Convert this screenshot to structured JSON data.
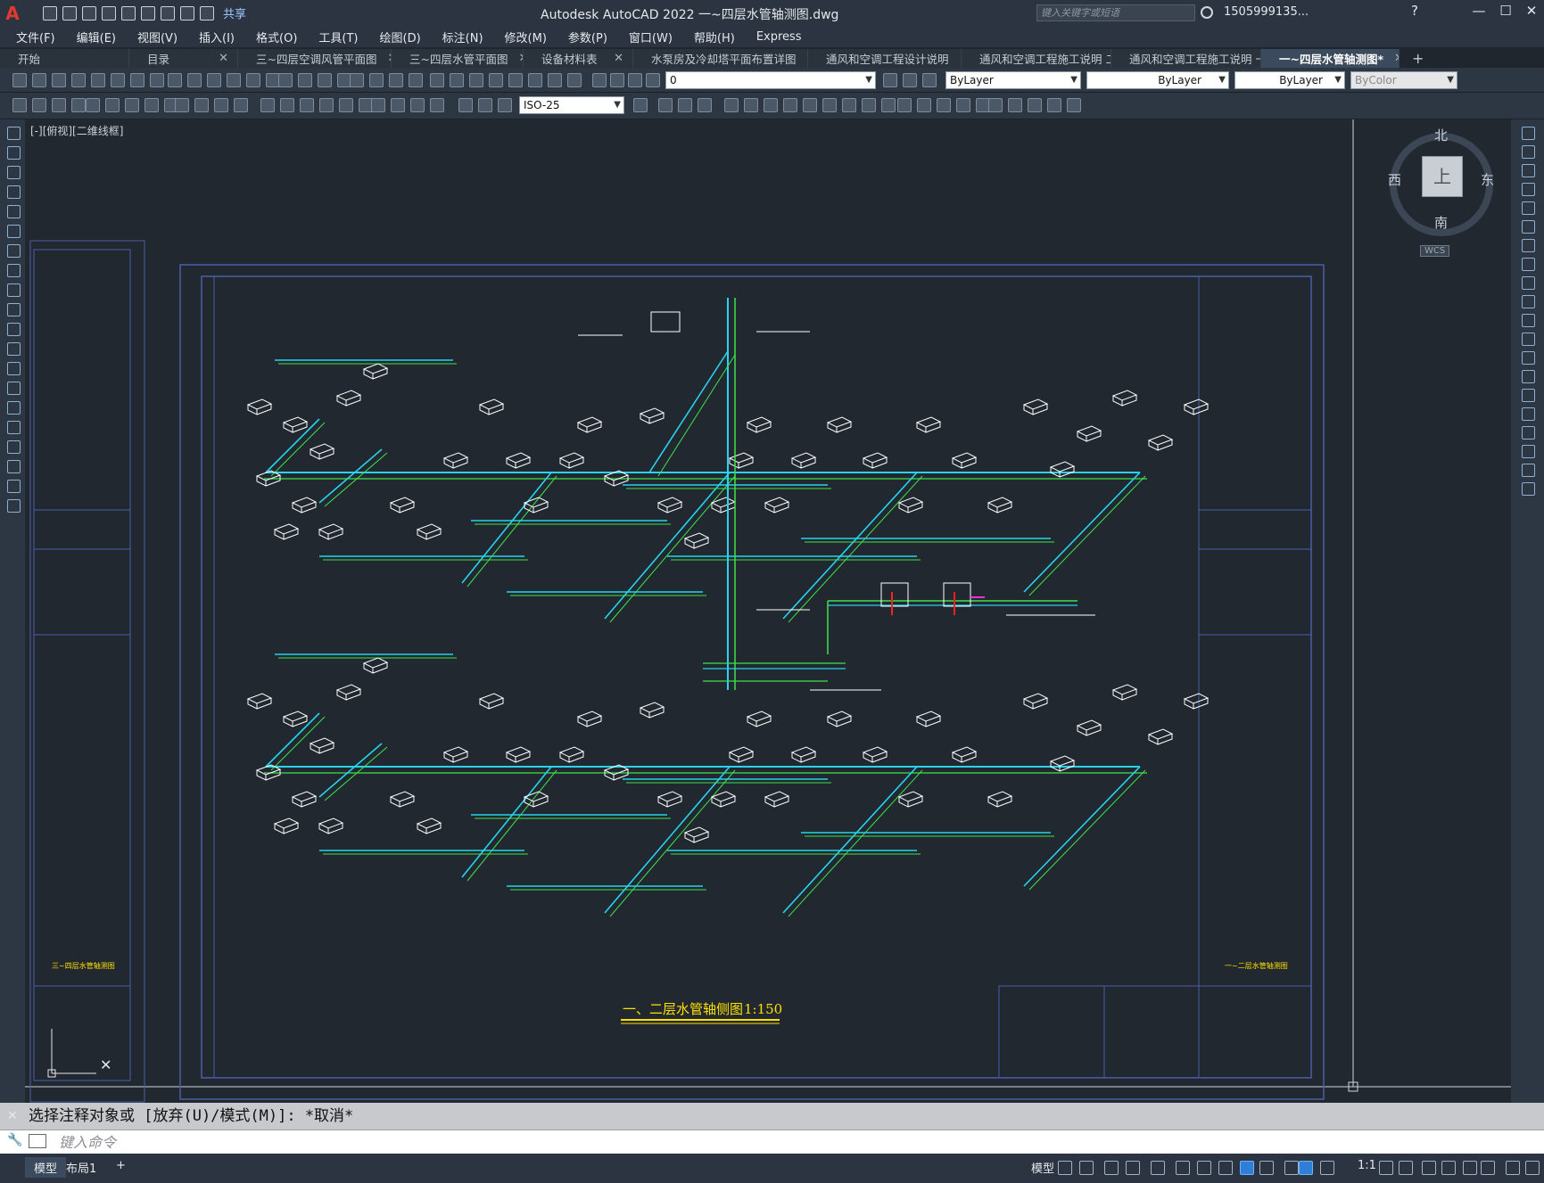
{
  "window": {
    "title": "Autodesk AutoCAD 2022    一~四层水管轴测图.dwg",
    "search_placeholder": "键入关键字或短语",
    "user": "1505999135...",
    "share": "共享",
    "app_logo": "A"
  },
  "menu": [
    "文件(F)",
    "编辑(E)",
    "视图(V)",
    "插入(I)",
    "格式(O)",
    "工具(T)",
    "绘图(D)",
    "标注(N)",
    "修改(M)",
    "参数(P)",
    "窗口(W)",
    "帮助(H)",
    "Express"
  ],
  "tabs": [
    {
      "label": "开始",
      "closable": false,
      "active": false
    },
    {
      "label": "目录",
      "closable": true,
      "active": false
    },
    {
      "label": "三~四层空调风管平面图",
      "closable": true,
      "active": false
    },
    {
      "label": "三~四层水管平面图",
      "closable": true,
      "active": false
    },
    {
      "label": "设备材料表",
      "closable": true,
      "active": false
    },
    {
      "label": "水泵房及冷却塔平面布置详图",
      "closable": true,
      "active": false
    },
    {
      "label": "通风和空调工程设计说明",
      "closable": true,
      "active": false
    },
    {
      "label": "通风和空调工程施工说明 二",
      "closable": true,
      "active": false
    },
    {
      "label": "通风和空调工程施工说明 一",
      "closable": true,
      "active": false
    },
    {
      "label": "一~四层水管轴测图*",
      "closable": true,
      "active": true
    }
  ],
  "toolbar": {
    "layer": "0",
    "color": "ByLayer",
    "linetype": "ByLayer",
    "lineweight": "ByLayer",
    "plotstyle": "ByColor",
    "dimstyle": "ISO-25"
  },
  "viewport": {
    "label": "[-][俯视][二维线框]",
    "drawing_title": "一、二层水管轴侧图",
    "drawing_scale": "1:150",
    "left_sheet_title": "三~四层水管轴测图",
    "right_sheet_title": "一~二层水管轴测图"
  },
  "viewcube": {
    "north": "北",
    "south": "南",
    "east": "东",
    "west": "西",
    "face": "上",
    "ucs": "WCS"
  },
  "command": {
    "history": "选择注释对象或 [放弃(U)/模式(M)]: *取消*",
    "placeholder": "键入命令"
  },
  "status": {
    "tabs": [
      "模型",
      "布局1"
    ],
    "model_label": "模型",
    "scale": "1:1"
  },
  "colors": {
    "pipe_cyan": "#27d3ee",
    "pipe_green": "#3fe24a",
    "frame_blue": "#4b5fa8",
    "unit_white": "#ffffff",
    "title_yellow": "#ffe100",
    "accent_red": "#ff2020",
    "accent_magenta": "#ff2fd0"
  }
}
